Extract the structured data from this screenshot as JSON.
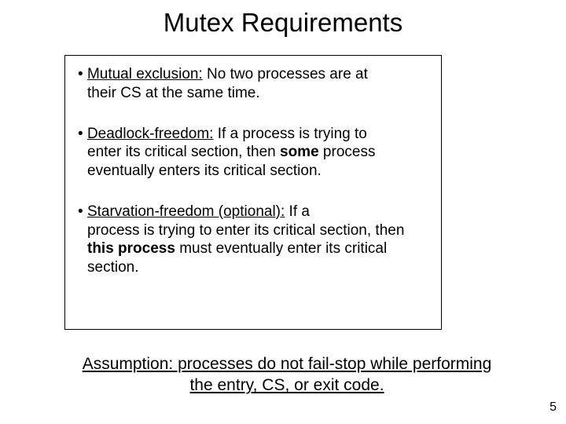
{
  "title": "Mutex Requirements",
  "bullets": [
    {
      "term": "Mutual exclusion:",
      "lead": " No two processes are at",
      "rest": "their CS at the same time."
    },
    {
      "term": "Deadlock-freedom:",
      "lead": " If a process is trying to",
      "rest_before": "enter its critical section, then ",
      "bold": "some",
      "rest_after": " process eventually enters its critical section."
    },
    {
      "term": "Starvation-freedom (optional):",
      "lead": " If a",
      "rest_before": "process is trying to enter its critical section, then ",
      "bold": "this process",
      "rest_after": " must eventually enter its critical section."
    }
  ],
  "assumption": "Assumption: processes do not fail-stop  while performing the entry, CS, or exit code.",
  "page": "5"
}
